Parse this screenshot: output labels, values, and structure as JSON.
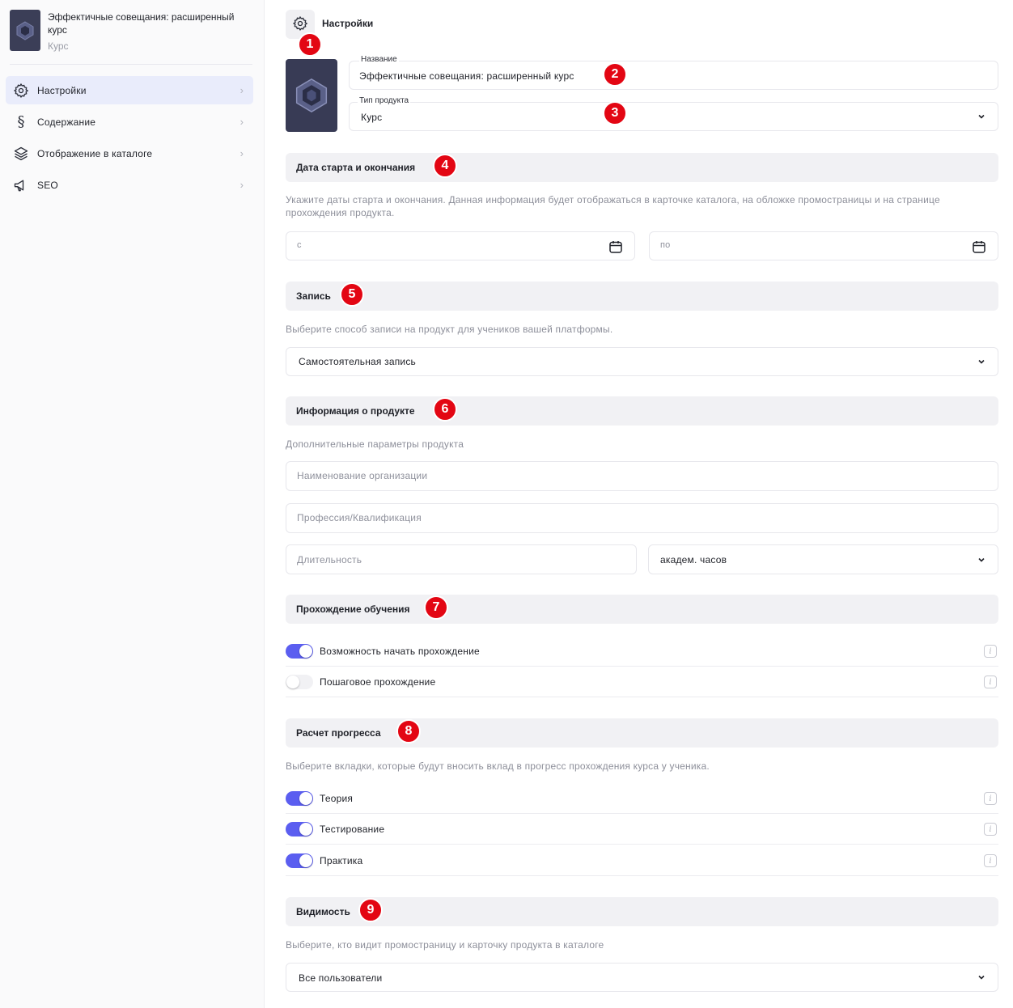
{
  "sidebar": {
    "course_title": "Эффектичные совещания: расширенный курс",
    "course_type": "Курс",
    "items": [
      {
        "label": "Настройки",
        "icon": "gear-icon",
        "active": true
      },
      {
        "label": "Содержание",
        "icon": "section-icon",
        "active": false
      },
      {
        "label": "Отображение в каталоге",
        "icon": "layers-icon",
        "active": false
      },
      {
        "label": "SEO",
        "icon": "megaphone-icon",
        "active": false
      }
    ]
  },
  "header": {
    "title": "Настройки"
  },
  "general": {
    "name_label": "Название",
    "name_value": "Эффектичные совещания: расширенный курс",
    "type_label": "Тип продукта",
    "type_value": "Курс"
  },
  "dates": {
    "title": "Дата старта и окончания",
    "description": "Укажите даты старта и окончания. Данная информация будет отображаться в карточке каталога, на обложке промостраницы и на странице прохождения продукта.",
    "from_placeholder": "с",
    "to_placeholder": "по"
  },
  "enrollment": {
    "title": "Запись",
    "description": "Выберите способ записи на продукт для учеников вашей платформы.",
    "selected": "Самостоятельная запись"
  },
  "product_info": {
    "title": "Информация о продукте",
    "description": "Дополнительные параметры продукта",
    "org_placeholder": "Наименование организации",
    "profession_placeholder": "Профессия/Квалификация",
    "duration_placeholder": "Длительность",
    "duration_unit": "академ. часов"
  },
  "learning": {
    "title": "Прохождение обучения",
    "toggles": [
      {
        "label": "Возможность начать прохождение",
        "on": true
      },
      {
        "label": "Пошаговое прохождение",
        "on": false
      }
    ]
  },
  "progress": {
    "title": "Расчет прогресса",
    "description": "Выберите вкладки, которые будут вносить вклад в прогресс прохождения курса у ученика.",
    "toggles": [
      {
        "label": "Теория",
        "on": true
      },
      {
        "label": "Тестирование",
        "on": true
      },
      {
        "label": "Практика",
        "on": true
      }
    ]
  },
  "visibility": {
    "title": "Видимость",
    "description": "Выберите, кто видит промостраницу и карточку продукта в каталоге",
    "selected": "Все пользователи"
  },
  "badges": [
    "1",
    "2",
    "3",
    "4",
    "5",
    "6",
    "7",
    "8",
    "9"
  ],
  "colors": {
    "accent": "#5b5ef0",
    "badge": "#e30613",
    "section_bg": "#f1f1f4",
    "active_nav": "#e9ecfb"
  }
}
